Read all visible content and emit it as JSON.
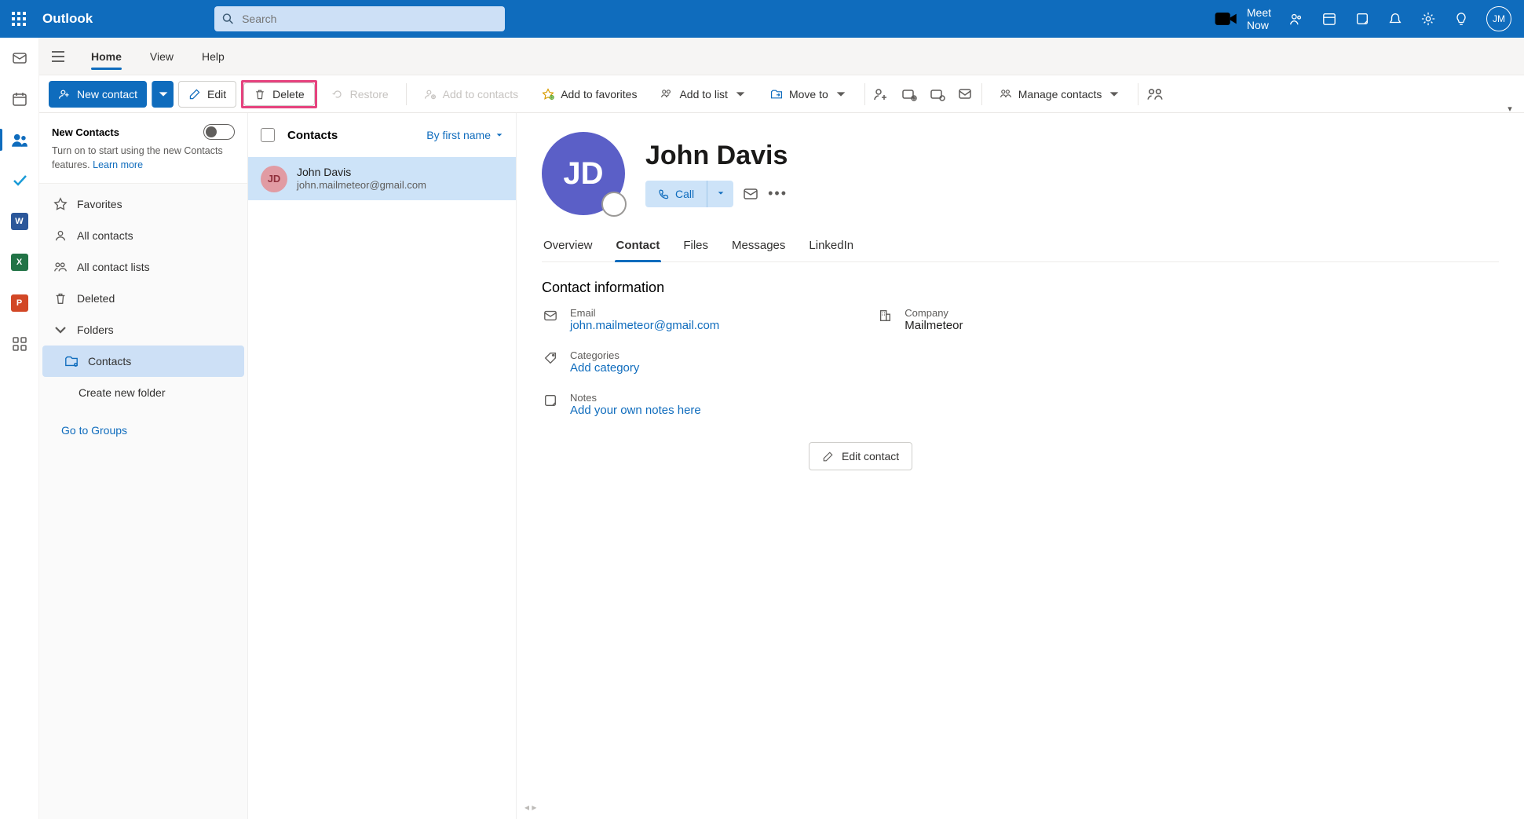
{
  "header": {
    "app_name": "Outlook",
    "search_placeholder": "Search",
    "meet_now": "Meet Now",
    "avatar_initials": "JM"
  },
  "tabs": {
    "home": "Home",
    "view": "View",
    "help": "Help"
  },
  "toolbar": {
    "new_contact": "New contact",
    "edit": "Edit",
    "delete": "Delete",
    "restore": "Restore",
    "add_to_contacts": "Add to contacts",
    "add_to_favorites": "Add to favorites",
    "add_to_list": "Add to list",
    "move_to": "Move to",
    "manage_contacts": "Manage contacts"
  },
  "sidebar": {
    "promo_title": "New Contacts",
    "promo_desc": "Turn on to start using the new Contacts features.",
    "learn_more": "Learn more",
    "favorites": "Favorites",
    "all_contacts": "All contacts",
    "all_contact_lists": "All contact lists",
    "deleted": "Deleted",
    "folders": "Folders",
    "contacts": "Contacts",
    "create_new_folder": "Create new folder",
    "go_to_groups": "Go to Groups"
  },
  "list": {
    "title": "Contacts",
    "sort": "By first name",
    "items": [
      {
        "initials": "JD",
        "name": "John Davis",
        "email": "john.mailmeteor@gmail.com"
      }
    ]
  },
  "detail": {
    "initials": "JD",
    "name": "John Davis",
    "call": "Call",
    "tabs": {
      "overview": "Overview",
      "contact": "Contact",
      "files": "Files",
      "messages": "Messages",
      "linkedin": "LinkedIn"
    },
    "section_title": "Contact information",
    "email_label": "Email",
    "email_value": "john.mailmeteor@gmail.com",
    "company_label": "Company",
    "company_value": "Mailmeteor",
    "categories_label": "Categories",
    "categories_action": "Add category",
    "notes_label": "Notes",
    "notes_action": "Add your own notes here",
    "edit_contact": "Edit contact"
  }
}
